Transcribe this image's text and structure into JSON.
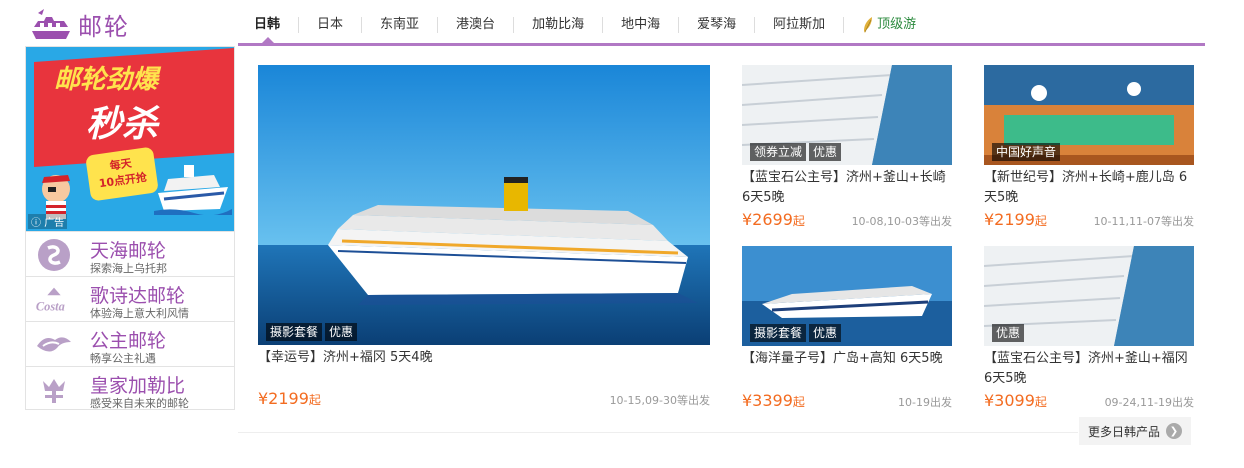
{
  "logo": {
    "text": "邮轮"
  },
  "tabs": [
    {
      "label": "日韩",
      "active": true
    },
    {
      "label": "日本"
    },
    {
      "label": "东南亚"
    },
    {
      "label": "港澳台"
    },
    {
      "label": "加勒比海"
    },
    {
      "label": "地中海"
    },
    {
      "label": "爱琴海"
    },
    {
      "label": "阿拉斯加"
    },
    {
      "label": "顶级游",
      "icon": "feather-icon"
    }
  ],
  "ad": {
    "line1": "邮轮劲爆",
    "line2": "秒杀",
    "badge_line1": "每天",
    "badge_line2": "10点开抢",
    "label": "广告"
  },
  "brands": [
    {
      "name": "天海邮轮",
      "desc": "探索海上乌托邦",
      "icon": "skysea-icon"
    },
    {
      "name": "歌诗达邮轮",
      "desc": "体验海上意大利风情",
      "icon": "costa-icon"
    },
    {
      "name": "公主邮轮",
      "desc": "畅享公主礼遇",
      "icon": "princess-icon"
    },
    {
      "name": "皇家加勒比",
      "desc": "感受来自未来的邮轮",
      "icon": "royal-crown-icon"
    }
  ],
  "products": [
    {
      "tags": [
        "摄影套餐",
        "优惠"
      ],
      "title": "【幸运号】济州+福冈 5天4晚",
      "price": "¥2199",
      "price_suffix": "起",
      "date": "10-15,09-30等出发"
    },
    {
      "tags": [
        "领券立减",
        "优惠"
      ],
      "title": "【蓝宝石公主号】济州+釜山+长崎 6天5晚",
      "price": "¥2699",
      "price_suffix": "起",
      "date": "10-08,10-03等出发"
    },
    {
      "tags": [
        "中国好声音"
      ],
      "title": "【新世纪号】济州+长崎+鹿儿岛 6天5晚",
      "price": "¥2199",
      "price_suffix": "起",
      "date": "10-11,11-07等出发"
    },
    {
      "tags": [
        "摄影套餐",
        "优惠"
      ],
      "title": "【海洋量子号】广岛+高知 6天5晚",
      "price": "¥3399",
      "price_suffix": "起",
      "date": "10-19出发"
    },
    {
      "tags": [
        "优惠"
      ],
      "title": "【蓝宝石公主号】济州+釜山+福冈 6天5晚",
      "price": "¥3099",
      "price_suffix": "起",
      "date": "09-24,11-19出发"
    }
  ],
  "more": {
    "label": "更多日韩产品"
  },
  "colors": {
    "brand": "#9b4fae",
    "nav_line": "#b178c4",
    "price": "#f36c21"
  }
}
